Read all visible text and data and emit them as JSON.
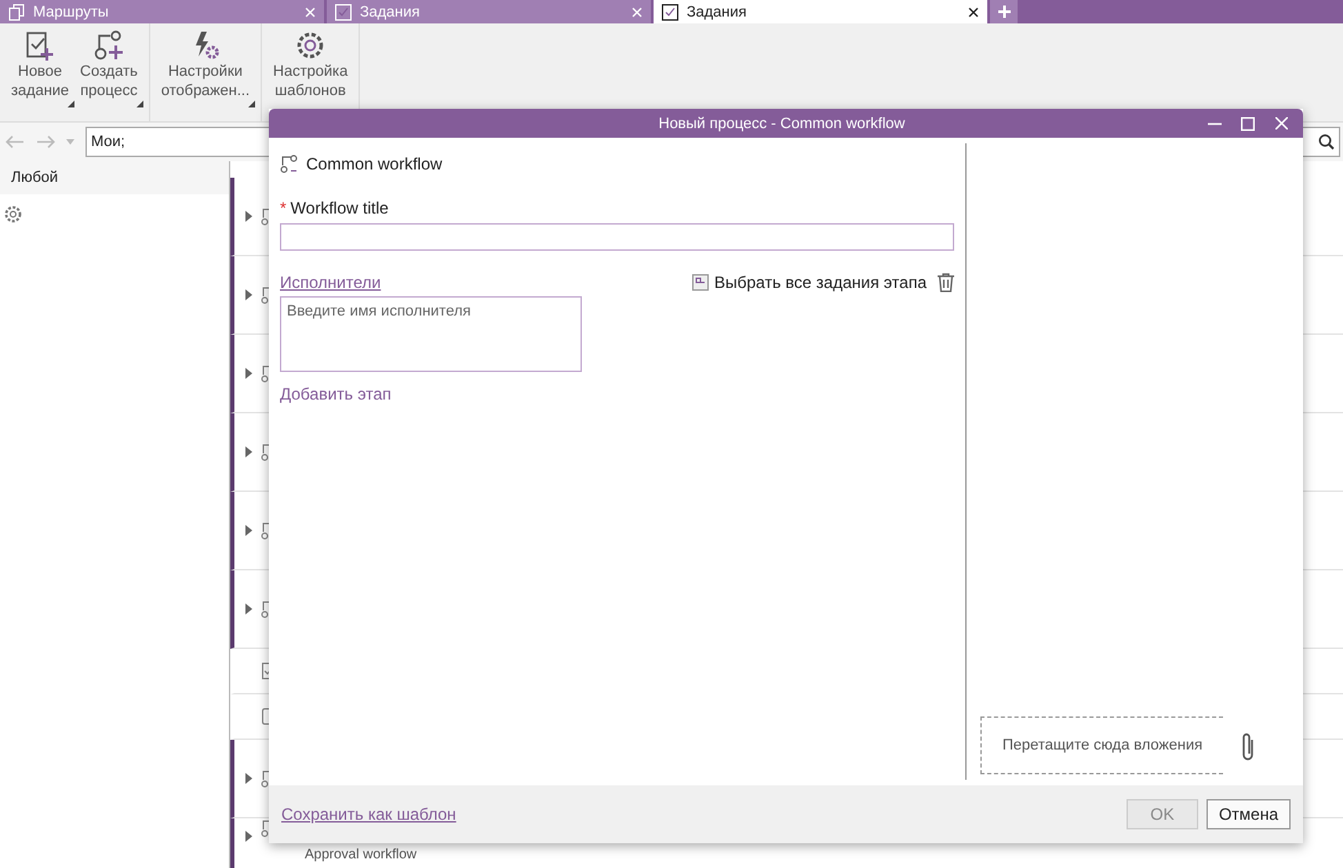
{
  "tabs": [
    {
      "label": "Маршруты",
      "kind": "routes",
      "selected": false
    },
    {
      "label": "Задания",
      "kind": "tasks",
      "selected": false
    },
    {
      "label": "Задания",
      "kind": "tasks",
      "selected": true
    }
  ],
  "ribbon": [
    {
      "lines": [
        "Новое",
        "задание"
      ],
      "kind": "new-task",
      "dropdown": true
    },
    {
      "lines": [
        "Создать",
        "процесс"
      ],
      "kind": "new-process",
      "dropdown": true
    },
    {
      "lines": [
        "Настройки",
        "отображен..."
      ],
      "kind": "display",
      "dropdown": true
    },
    {
      "lines": [
        "Настройка",
        "шаблонов"
      ],
      "kind": "gear",
      "dropdown": false
    }
  ],
  "search": {
    "value": "Мои;"
  },
  "filter": {
    "label": "Любой"
  },
  "rows": [
    {
      "kind": "workflow"
    },
    {
      "kind": "workflow"
    },
    {
      "kind": "workflow"
    },
    {
      "kind": "workflow"
    },
    {
      "kind": "workflow"
    },
    {
      "kind": "workflow"
    },
    {
      "kind": "task"
    },
    {
      "kind": "doc"
    },
    {
      "kind": "workflow"
    },
    {
      "kind": "workflow",
      "subtitle": "Approval workflow"
    }
  ],
  "dialog": {
    "title": "Новый процесс - Common workflow",
    "header": "Common workflow",
    "field": {
      "label": "Workflow title",
      "marker": "*"
    },
    "performers_link": "Исполнители",
    "select_all": "Выбрать все задания этапа",
    "performers": {
      "placeholder": "Введите имя исполнителя"
    },
    "add_stage": "Добавить этап",
    "drop_zone": "Перетащите сюда вложения",
    "save_template": "Сохранить как шаблон",
    "buttons": [
      {
        "label": "OK",
        "disabled": true
      },
      {
        "label": "Отмена",
        "disabled": false
      }
    ]
  }
}
